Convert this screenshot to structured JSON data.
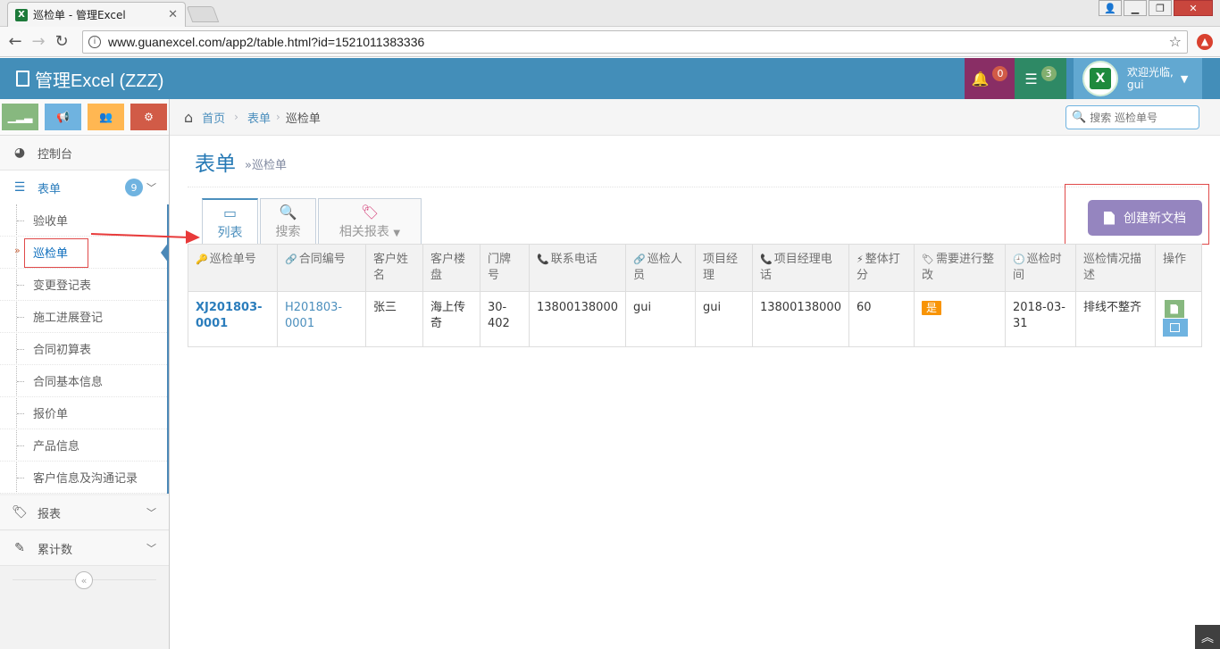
{
  "browser": {
    "tab_title": "巡检单 - 管理Excel",
    "tab_icon_letter": "X",
    "url": "www.guanexcel.com/app2/table.html?id=1521011383336"
  },
  "navbar": {
    "brand": "管理Excel (ZZZ)",
    "notifications_count": "0",
    "tasks_count": "3",
    "avatar_letter": "X",
    "welcome": "欢迎光临,",
    "username": "gui"
  },
  "sidebar": {
    "dashboard": "控制台",
    "forms": "表单",
    "forms_badge": "9",
    "sub_items": [
      "验收单",
      "巡检单",
      "变更登记表",
      "施工进展登记",
      "合同初算表",
      "合同基本信息",
      "报价单",
      "产品信息",
      "客户信息及沟通记录"
    ],
    "reports": "报表",
    "accumulate": "累计数"
  },
  "breadcrumbs": {
    "home": "首页",
    "forms": "表单",
    "current": "巡检单"
  },
  "search": {
    "placeholder": "搜索 巡检单号"
  },
  "page": {
    "title": "表单",
    "subtitle": "»巡检单",
    "create_button": "创建新文档"
  },
  "tabs": [
    {
      "label": "列表"
    },
    {
      "label": "搜索"
    },
    {
      "label": "相关报表"
    }
  ],
  "table": {
    "headers": [
      "巡检单号",
      "合同编号",
      "客户姓名",
      "客户楼盘",
      "门牌号",
      "联系电话",
      "巡检人员",
      "项目经理",
      "项目经理电话",
      "整体打分",
      "需要进行整改",
      "巡检时间",
      "巡检情况描述",
      "操作"
    ],
    "rows": [
      [
        "XJ201803-0001",
        "H201803-0001",
        "张三",
        "海上传奇",
        "30-402",
        "13800138000",
        "gui",
        "gui",
        "13800138000",
        "60",
        "是",
        "2018-03-31",
        "排线不整齐",
        ""
      ]
    ]
  },
  "colors": {
    "navbar": "#438eb9",
    "accent": "#2679b5",
    "create_button": "#9585bf",
    "badge_warning": "#f89406"
  }
}
